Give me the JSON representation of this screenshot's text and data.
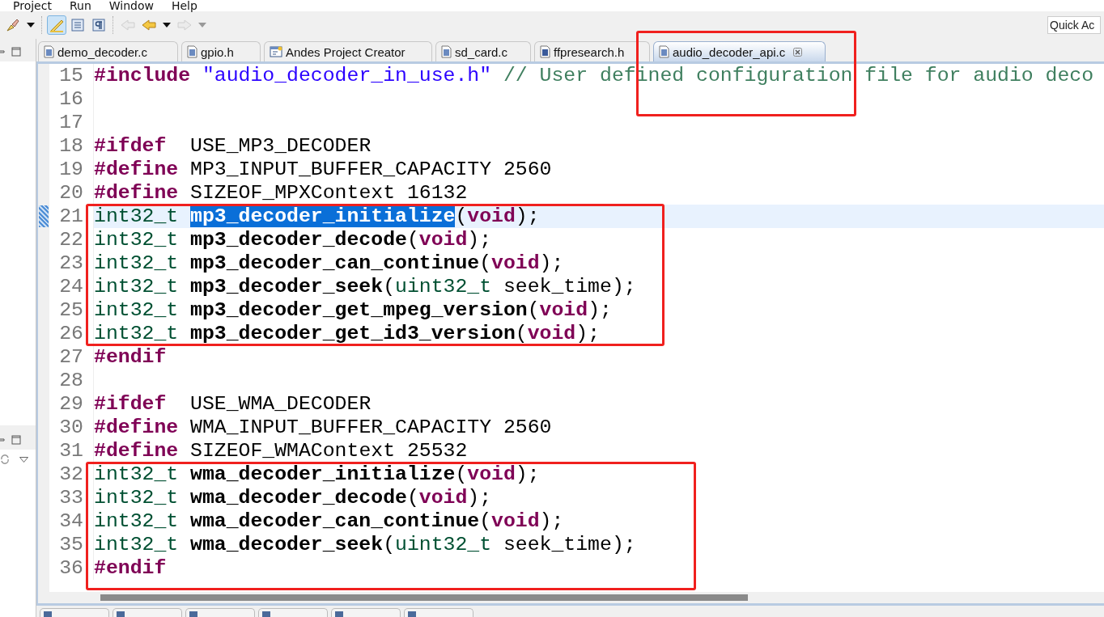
{
  "menu": [
    {
      "label": "Project"
    },
    {
      "label": "Run"
    },
    {
      "label": "Window"
    },
    {
      "label": "Help"
    }
  ],
  "toolbar": [
    {
      "kind": "brush",
      "pressed": false,
      "disabled": false,
      "dropdown": true
    },
    {
      "kind": "highlight",
      "pressed": true,
      "disabled": false,
      "dropdown": false
    },
    {
      "kind": "block",
      "pressed": false,
      "disabled": false,
      "dropdown": false
    },
    {
      "kind": "pilcrow",
      "pressed": false,
      "disabled": false,
      "dropdown": false
    },
    {
      "kind": "last_edit",
      "pressed": false,
      "disabled": true,
      "dropdown": false
    },
    {
      "kind": "back",
      "pressed": false,
      "disabled": false,
      "dropdown": true
    },
    {
      "kind": "forward",
      "pressed": false,
      "disabled": true,
      "dropdown": true
    }
  ],
  "quick_access": {
    "placeholder": "Quick Ac"
  },
  "editor_tabs": [
    {
      "label": "demo_decoder.c",
      "kind": "c",
      "selected": false,
      "closable": false
    },
    {
      "label": "gpio.h",
      "kind": "c",
      "selected": false,
      "closable": false
    },
    {
      "label": "Andes Project Creator",
      "kind": "project",
      "selected": false,
      "closable": false
    },
    {
      "label": "sd_card.c",
      "kind": "c",
      "selected": false,
      "closable": false
    },
    {
      "label": "ffpresearch.h",
      "kind": "h",
      "selected": false,
      "closable": false
    },
    {
      "label": "audio_decoder_api.c",
      "kind": "c",
      "selected": true,
      "closable": true
    }
  ],
  "code_lines": [
    {
      "number": "15",
      "current": false,
      "tokens": [
        {
          "kind": "directive",
          "text": "#include "
        },
        {
          "kind": "string",
          "text": "\"audio_decoder_in_use.h\" "
        },
        {
          "kind": "comment",
          "text": "// User defined configuration file for audio deco"
        }
      ]
    },
    {
      "number": "16",
      "current": false
    },
    {
      "number": "17",
      "current": false
    },
    {
      "number": "18",
      "current": false,
      "tokens": [
        {
          "kind": "directive",
          "text": "#ifdef"
        },
        {
          "kind": "plain",
          "text": "  USE_MP3_DECODER"
        }
      ]
    },
    {
      "number": "19",
      "current": false,
      "tokens": [
        {
          "kind": "directive",
          "text": "#define"
        },
        {
          "kind": "plain",
          "text": " MP3_INPUT_BUFFER_CAPACITY 2560"
        }
      ]
    },
    {
      "number": "20",
      "current": false,
      "tokens": [
        {
          "kind": "directive",
          "text": "#define"
        },
        {
          "kind": "plain",
          "text": " SIZEOF_MPXContext 16132"
        }
      ]
    },
    {
      "number": "21",
      "current": true,
      "tokens": [
        {
          "kind": "type",
          "text": "int32_t "
        },
        {
          "kind": "selection",
          "text": "mp3_decoder_initialize"
        },
        {
          "kind": "plain",
          "text": "("
        },
        {
          "kind": "keyword",
          "text": "void"
        },
        {
          "kind": "plain",
          "text": ");"
        }
      ]
    },
    {
      "number": "22",
      "current": false,
      "tokens": [
        {
          "kind": "type",
          "text": "int32_t "
        },
        {
          "kind": "func",
          "text": "mp3_decoder_decode"
        },
        {
          "kind": "plain",
          "text": "("
        },
        {
          "kind": "keyword",
          "text": "void"
        },
        {
          "kind": "plain",
          "text": ");"
        }
      ]
    },
    {
      "number": "23",
      "current": false,
      "tokens": [
        {
          "kind": "type",
          "text": "int32_t "
        },
        {
          "kind": "func",
          "text": "mp3_decoder_can_continue"
        },
        {
          "kind": "plain",
          "text": "("
        },
        {
          "kind": "keyword",
          "text": "void"
        },
        {
          "kind": "plain",
          "text": ");"
        }
      ]
    },
    {
      "number": "24",
      "current": false,
      "tokens": [
        {
          "kind": "type",
          "text": "int32_t "
        },
        {
          "kind": "func",
          "text": "mp3_decoder_seek"
        },
        {
          "kind": "plain",
          "text": "("
        },
        {
          "kind": "type",
          "text": "uint32_t"
        },
        {
          "kind": "plain",
          "text": " seek_time);"
        }
      ]
    },
    {
      "number": "25",
      "current": false,
      "tokens": [
        {
          "kind": "type",
          "text": "int32_t "
        },
        {
          "kind": "func",
          "text": "mp3_decoder_get_mpeg_version"
        },
        {
          "kind": "plain",
          "text": "("
        },
        {
          "kind": "keyword",
          "text": "void"
        },
        {
          "kind": "plain",
          "text": ");"
        }
      ]
    },
    {
      "number": "26",
      "current": false,
      "tokens": [
        {
          "kind": "type",
          "text": "int32_t "
        },
        {
          "kind": "func",
          "text": "mp3_decoder_get_id3_version"
        },
        {
          "kind": "plain",
          "text": "("
        },
        {
          "kind": "keyword",
          "text": "void"
        },
        {
          "kind": "plain",
          "text": ");"
        }
      ]
    },
    {
      "number": "27",
      "current": false,
      "tokens": [
        {
          "kind": "directive",
          "text": "#endif"
        }
      ]
    },
    {
      "number": "28",
      "current": false
    },
    {
      "number": "29",
      "current": false,
      "tokens": [
        {
          "kind": "directive",
          "text": "#ifdef"
        },
        {
          "kind": "plain",
          "text": "  USE_WMA_DECODER"
        }
      ]
    },
    {
      "number": "30",
      "current": false,
      "tokens": [
        {
          "kind": "directive",
          "text": "#define"
        },
        {
          "kind": "plain",
          "text": " WMA_INPUT_BUFFER_CAPACITY 2560"
        }
      ]
    },
    {
      "number": "31",
      "current": false,
      "tokens": [
        {
          "kind": "directive",
          "text": "#define"
        },
        {
          "kind": "plain",
          "text": " SIZEOF_WMAContext 25532"
        }
      ]
    },
    {
      "number": "32",
      "current": false,
      "tokens": [
        {
          "kind": "type",
          "text": "int32_t "
        },
        {
          "kind": "func",
          "text": "wma_decoder_initialize"
        },
        {
          "kind": "plain",
          "text": "("
        },
        {
          "kind": "keyword",
          "text": "void"
        },
        {
          "kind": "plain",
          "text": ");"
        }
      ]
    },
    {
      "number": "33",
      "current": false,
      "tokens": [
        {
          "kind": "type",
          "text": "int32_t "
        },
        {
          "kind": "func",
          "text": "wma_decoder_decode"
        },
        {
          "kind": "plain",
          "text": "("
        },
        {
          "kind": "keyword",
          "text": "void"
        },
        {
          "kind": "plain",
          "text": ");"
        }
      ]
    },
    {
      "number": "34",
      "current": false,
      "tokens": [
        {
          "kind": "type",
          "text": "int32_t "
        },
        {
          "kind": "func",
          "text": "wma_decoder_can_continue"
        },
        {
          "kind": "plain",
          "text": "("
        },
        {
          "kind": "keyword",
          "text": "void"
        },
        {
          "kind": "plain",
          "text": ");"
        }
      ]
    },
    {
      "number": "35",
      "current": false,
      "tokens": [
        {
          "kind": "type",
          "text": "int32_t "
        },
        {
          "kind": "func",
          "text": "wma_decoder_seek"
        },
        {
          "kind": "plain",
          "text": "("
        },
        {
          "kind": "type",
          "text": "uint32_t"
        },
        {
          "kind": "plain",
          "text": " seek_time);"
        }
      ]
    },
    {
      "number": "36",
      "current": false,
      "tokens": [
        {
          "kind": "directive",
          "text": "#endif"
        }
      ]
    }
  ]
}
